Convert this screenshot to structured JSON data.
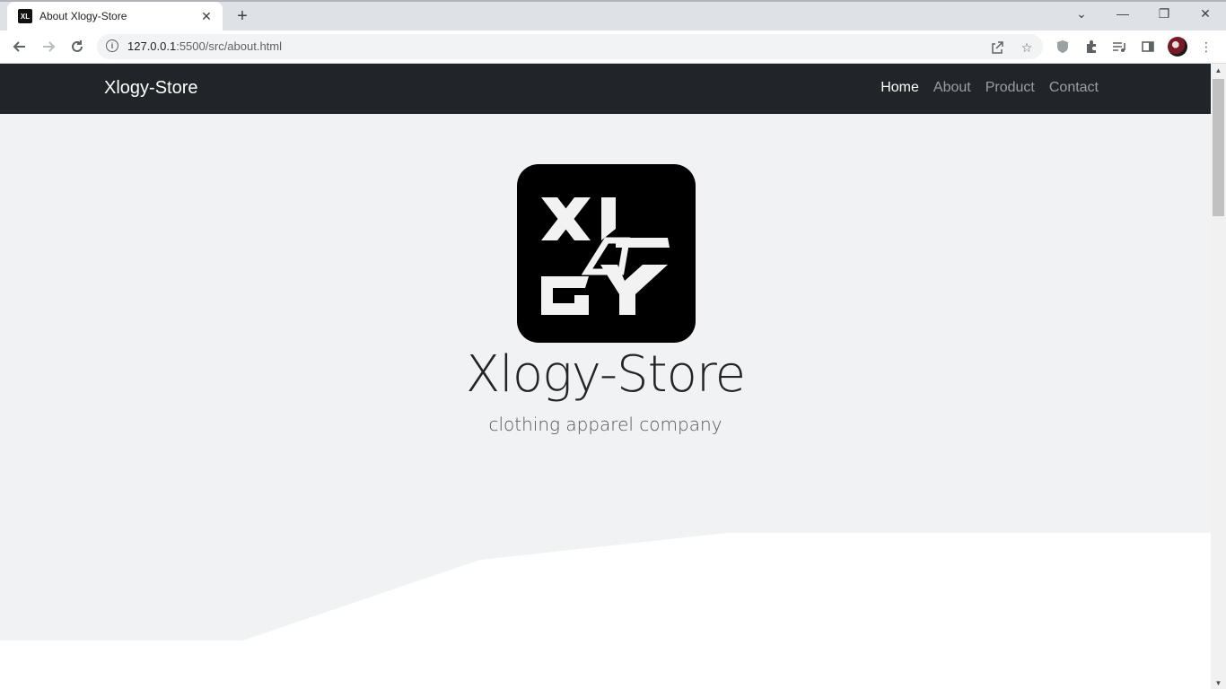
{
  "browser": {
    "tab_title": "About Xlogy-Store",
    "new_tab_label": "+",
    "url_host": "127.0.0.1",
    "url_path": ":5500/src/about.html"
  },
  "navbar": {
    "brand": "Xlogy-Store",
    "links": [
      {
        "label": "Home",
        "active": true
      },
      {
        "label": "About",
        "active": false
      },
      {
        "label": "Product",
        "active": false
      },
      {
        "label": "Contact",
        "active": false
      }
    ]
  },
  "hero": {
    "title": "Xlogy-Store",
    "subtitle": "clothing apparel company"
  },
  "icons": {
    "back": "arrow-left-icon",
    "forward": "arrow-right-icon",
    "reload": "reload-icon",
    "share": "share-icon",
    "bookmark": "star-icon",
    "extensions": "puzzle-icon",
    "menu": "kebab-menu-icon"
  },
  "colors": {
    "navbar_bg": "#212529",
    "hero_bg": "#f1f2f4",
    "logo_bg": "#000000"
  }
}
